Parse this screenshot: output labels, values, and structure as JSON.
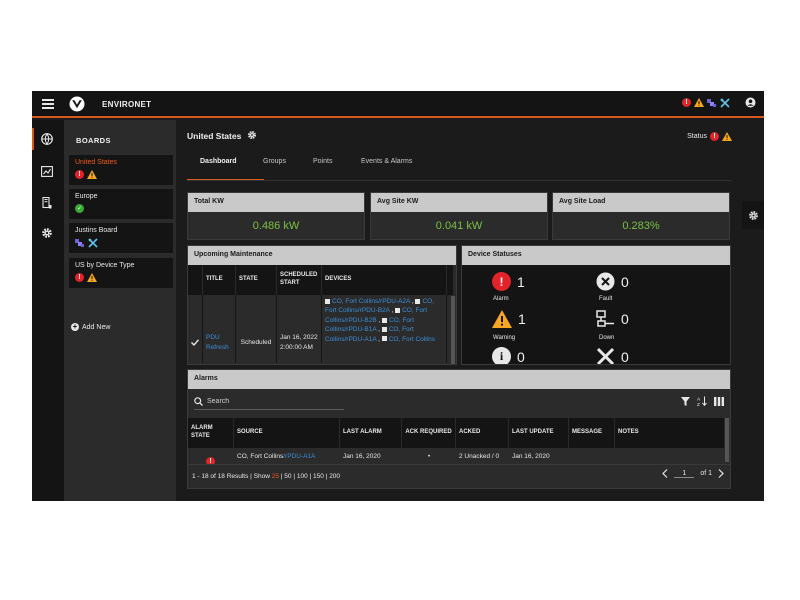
{
  "app": {
    "brand": "ENVIRONET",
    "colors": {
      "accent": "#d4581f",
      "ok": "#3aaa35",
      "alarm": "#e2232a",
      "warning": "#f5a623",
      "link": "#3c8ed8",
      "kpi_value": "#7bc043"
    },
    "top_icons": [
      "alarm-icon",
      "warning-icon",
      "multi-device-icon",
      "tools-icon",
      "user-icon"
    ]
  },
  "rail": {
    "items": [
      {
        "name": "globe-icon"
      },
      {
        "name": "reports-icon"
      },
      {
        "name": "devices-icon"
      },
      {
        "name": "settings-icon"
      }
    ]
  },
  "boards": {
    "title": "BOARDS",
    "items": [
      {
        "label": "United States",
        "icons": [
          "alarm-icon",
          "warning-icon"
        ],
        "selected": true
      },
      {
        "label": "Europe",
        "icons": [
          "ok-icon"
        ]
      },
      {
        "label": "Justins Board",
        "icons": [
          "multi-device-icon",
          "tools-icon"
        ]
      },
      {
        "label": "US by Device Type",
        "icons": [
          "alarm-icon",
          "warning-icon"
        ]
      }
    ],
    "add_new": "Add New"
  },
  "header": {
    "title": "United States",
    "status_label": "Status"
  },
  "tabs": [
    {
      "label": "Dashboard",
      "active": true
    },
    {
      "label": "Groups"
    },
    {
      "label": "Points"
    },
    {
      "label": "Events & Alarms"
    }
  ],
  "kpis": [
    {
      "label": "Total KW",
      "value": "0.486 kW"
    },
    {
      "label": "Avg Site KW",
      "value": "0.041 kW"
    },
    {
      "label": "Avg Site Load",
      "value": "0.283%"
    }
  ],
  "maintenance": {
    "title": "Upcoming Maintenance",
    "columns": [
      "TITLE",
      "STATE",
      "SCHEDULED START",
      "DEVICES"
    ],
    "row": {
      "title": "PDU Refresh",
      "state": "Scheduled",
      "start": "Jan 16, 2022 2:00:00 AM",
      "devices": [
        {
          "name": "CO, Fort Collins/rPDU-A2A"
        },
        {
          "name": "CO, Fort Collins/rPDU-B2A"
        },
        {
          "name": "CO, Fort Collins/rPDU-B2B"
        },
        {
          "name": "CO, Fort Collins/rPDU-B1A"
        },
        {
          "name": "CO, Fort Collins/rPDU-A1A"
        },
        {
          "name": "CO, Fort Collins"
        }
      ]
    }
  },
  "device_statuses": {
    "title": "Device Statuses",
    "items": [
      {
        "label": "Alarm",
        "count": "1"
      },
      {
        "label": "Fault",
        "count": "0"
      },
      {
        "label": "Warning",
        "count": "1"
      },
      {
        "label": "Down",
        "count": "0"
      },
      {
        "count": "0"
      },
      {
        "count": "0"
      }
    ]
  },
  "alarms": {
    "title": "Alarms",
    "search_placeholder": "Search",
    "columns": [
      "ALARM STATE",
      "SOURCE",
      "LAST ALARM",
      "ACK REQUIRED",
      "ACKED",
      "LAST UPDATE",
      "MESSAGE",
      "NOTES"
    ],
    "row": {
      "source_prefix": "CO, Fort Collins",
      "source_device": "/rPDU-A1A",
      "last_alarm": "Jan 16, 2020",
      "acked": "2 Unacked / 0",
      "last_update": "Jan 16, 2020"
    },
    "footer": {
      "results": "1 - 18 of 18 Results | Show",
      "page_sizes": [
        "25",
        "50",
        "100",
        "150",
        "200"
      ],
      "page": "1",
      "of_pages": "of 1"
    }
  }
}
